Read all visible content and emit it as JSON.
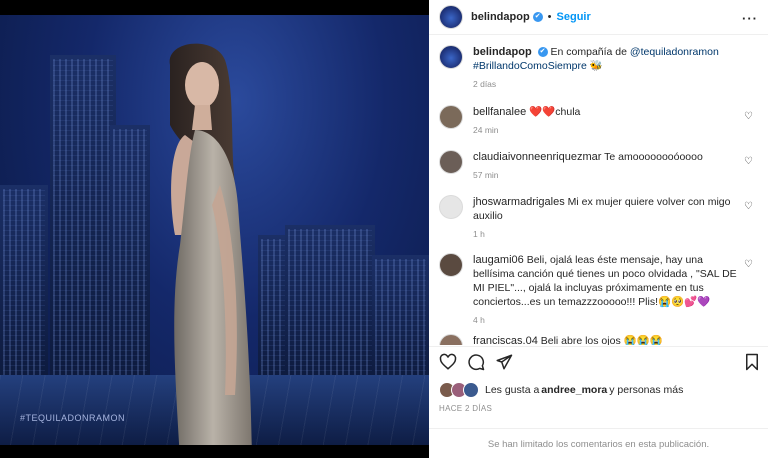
{
  "post": {
    "watermark": "#TEQUILADONRAMON"
  },
  "header": {
    "username": "belindapop",
    "verified_mark": "✔",
    "separator": "•",
    "follow_label": "Seguir",
    "more_label": "···"
  },
  "caption": {
    "username": "belindapop",
    "text_before": "En compañía de ",
    "mention": "@tequiladonramon",
    "hashtag": "#BrillandoComoSiempre",
    "emoji": "🐝",
    "time": "2 días"
  },
  "comments": [
    {
      "user": "bellfanalee",
      "text": "❤️❤️chula",
      "time": "24 min",
      "avatar_color": "#7b6a5a"
    },
    {
      "user": "claudiaivonneenriquezmar",
      "text": "Te amoooooooóoooo",
      "time": "57 min",
      "avatar_color": "#6b5e57"
    },
    {
      "user": "jhoswarmadrigales",
      "text": "Mi ex mujer quiere volver con migo auxilio",
      "time": "1 h",
      "avatar_color": "#e6e6e6"
    },
    {
      "user": "laugami06",
      "text": "Beli, ojalá leas éste mensaje, hay una bellísima canción qué tienes un poco olvidada , \"SAL DE MI PIEL\"..., ojalá la incluyas próximamente en tus conciertos...es un temazzzooooo!!! Plis!😭🥺💕💜",
      "time": "4 h",
      "avatar_color": "#5a4a40"
    },
    {
      "user": "franciscas.04",
      "text": "Beli abre los ojos 😭😭😭",
      "time": "",
      "avatar_color": "#8a7060"
    }
  ],
  "likes": {
    "prefix": "Les gusta a ",
    "user": "andree_mora",
    "suffix": " y personas más"
  },
  "posted_ago": "HACE 2 DÍAS",
  "comments_limited": "Se han limitado los comentarios en esta publicación.",
  "icons": [
    "heart-icon",
    "comment-icon",
    "share-icon",
    "bookmark-icon",
    "more-icon",
    "verified-icon"
  ]
}
